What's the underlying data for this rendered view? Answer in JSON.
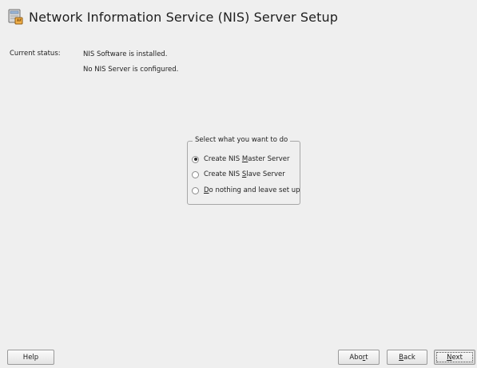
{
  "header": {
    "title": "Network Information Service (NIS) Server Setup",
    "icon": "nis-server-icon"
  },
  "status": {
    "label": "Current status:",
    "lines": [
      "NIS Software is installed.",
      "No NIS Server is configured."
    ]
  },
  "options": {
    "title": "Select what you want to do",
    "items": [
      {
        "before": "Create NIS ",
        "accel": "M",
        "after": "aster Server",
        "selected": true
      },
      {
        "before": "Create NIS ",
        "accel": "S",
        "after": "lave Server",
        "selected": false
      },
      {
        "before": "",
        "accel": "D",
        "after": "o nothing and leave set up",
        "selected": false
      }
    ]
  },
  "buttons": {
    "help": "Help",
    "abort": {
      "before": "Abo",
      "accel": "r",
      "after": "t"
    },
    "back": {
      "before": "",
      "accel": "B",
      "after": "ack"
    },
    "next": {
      "before": "",
      "accel": "N",
      "after": "ext"
    }
  },
  "colors": {
    "background": "#efefef",
    "border": "#a7a7a7"
  }
}
